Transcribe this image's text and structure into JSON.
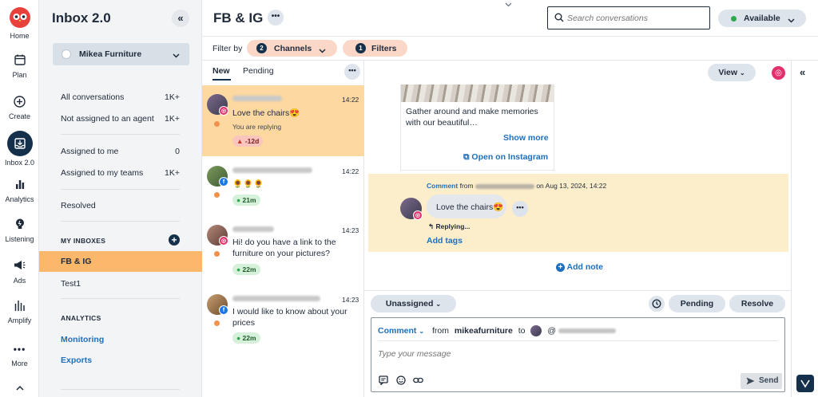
{
  "nav": {
    "items": [
      {
        "label": "Home",
        "icon": "owl-logo"
      },
      {
        "label": "Plan",
        "icon": "calendar-icon"
      },
      {
        "label": "Create",
        "icon": "plus-circle-icon"
      },
      {
        "label": "Inbox 2.0",
        "icon": "inbox-icon"
      },
      {
        "label": "Analytics",
        "icon": "bar-chart-icon"
      },
      {
        "label": "Listening",
        "icon": "lightbulb-icon"
      },
      {
        "label": "Ads",
        "icon": "megaphone-icon"
      },
      {
        "label": "Amplify",
        "icon": "amplify-icon"
      },
      {
        "label": "More",
        "icon": "more-icon"
      }
    ]
  },
  "sidebar": {
    "title": "Inbox 2.0",
    "org": "Mikea Furniture",
    "items": [
      {
        "label": "All conversations",
        "count": "1K+"
      },
      {
        "label": "Not assigned to an agent",
        "count": "1K+"
      },
      {
        "label": "Assigned to me",
        "count": "0"
      },
      {
        "label": "Assigned to my teams",
        "count": "1K+"
      },
      {
        "label": "Resolved",
        "count": ""
      }
    ],
    "my_inboxes_heading": "MY INBOXES",
    "inboxes": [
      "FB & IG",
      "Test1"
    ],
    "analytics_heading": "ANALYTICS",
    "analytics_links": [
      "Monitoring",
      "Exports"
    ]
  },
  "header": {
    "title": "FB & IG",
    "search_placeholder": "Search conversations",
    "status": "Available",
    "filter_by": "Filter by",
    "channels_count": "2",
    "channels_label": "Channels",
    "filters_count": "1",
    "filters_label": "Filters"
  },
  "list": {
    "tabs": [
      "New",
      "Pending"
    ],
    "conversations": [
      {
        "time": "14:22",
        "text": "Love the chairs😍",
        "sub": "You are replying",
        "tag": "-12d",
        "channel": "instagram"
      },
      {
        "time": "14:22",
        "text": "🌻🌻🌻",
        "sub": "",
        "tag": "21m",
        "channel": "facebook"
      },
      {
        "time": "14:23",
        "text": "Hi! do you have a link to the furniture on your pictures?",
        "sub": "",
        "tag": "22m",
        "channel": "instagram"
      },
      {
        "time": "14:23",
        "text": "I would like to know about your prices",
        "sub": "",
        "tag": "22m",
        "channel": "facebook"
      }
    ]
  },
  "main": {
    "view_label": "View",
    "post_text": "Gather around and make memories with our beautiful…",
    "show_more": "Show more",
    "open_instagram": "Open on Instagram",
    "comment_prefix": "Comment",
    "comment_from": "from",
    "comment_date": "on Aug 13, 2024, 14:22",
    "comment_text": "Love the chairs😍",
    "replying": "Replying...",
    "add_tags": "Add tags",
    "add_note": "Add note",
    "assign_label": "Unassigned",
    "pending_label": "Pending",
    "resolve_label": "Resolve",
    "reply_type": "Comment",
    "reply_from": "from",
    "reply_account": "mikeafurniture",
    "reply_to": "to",
    "reply_handle_prefix": "@",
    "message_placeholder": "Type your message",
    "send_label": "Send"
  },
  "colors": {
    "accent": "#1e6fbf",
    "selected": "#fdd8a0",
    "highlight": "#fdeecb",
    "pill_salmon": "#fbd7c8",
    "status_green": "#2fa84f"
  }
}
